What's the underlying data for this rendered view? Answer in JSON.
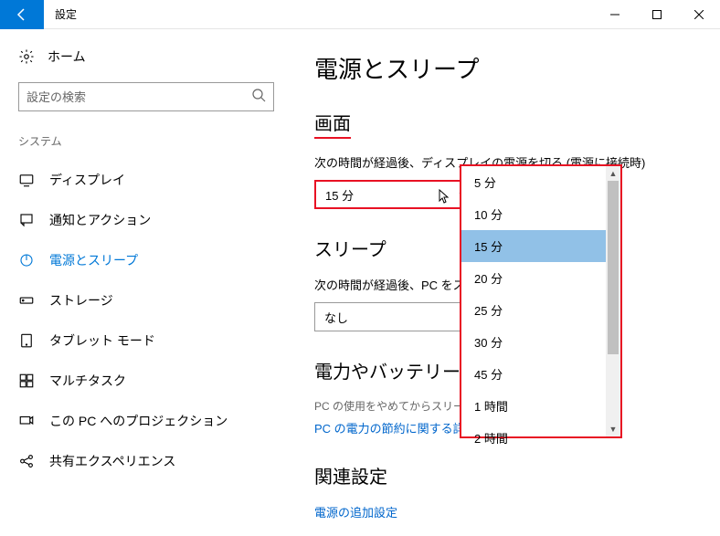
{
  "titlebar": {
    "title": "設定"
  },
  "sidebar": {
    "home": "ホーム",
    "search_placeholder": "設定の検索",
    "category": "システム",
    "items": [
      {
        "label": "ディスプレイ"
      },
      {
        "label": "通知とアクション"
      },
      {
        "label": "電源とスリープ"
      },
      {
        "label": "ストレージ"
      },
      {
        "label": "タブレット モード"
      },
      {
        "label": "マルチタスク"
      },
      {
        "label": "この PC へのプロジェクション"
      },
      {
        "label": "共有エクスペリエンス"
      }
    ]
  },
  "main": {
    "title": "電源とスリープ",
    "screen": {
      "heading": "画面",
      "label": "次の時間が経過後、ディスプレイの電源を切る (電源に接続時)",
      "value": "15 分"
    },
    "sleep": {
      "heading": "スリープ",
      "label": "次の時間が経過後、PC をスリープ状態にする (電源に接続時)",
      "value": "なし"
    },
    "battery": {
      "heading": "電力やバッテリー残量を節約する",
      "desc": "PC の使用をやめてからスリープ状態になるまでの時間を短くします。",
      "link": "PC の電力の節約に関する詳しい情報"
    },
    "related": {
      "heading": "関連設定",
      "link": "電源の追加設定"
    },
    "dropdown_options": [
      "5 分",
      "10 分",
      "15 分",
      "20 分",
      "25 分",
      "30 分",
      "45 分",
      "1 時間",
      "2 時間"
    ]
  }
}
